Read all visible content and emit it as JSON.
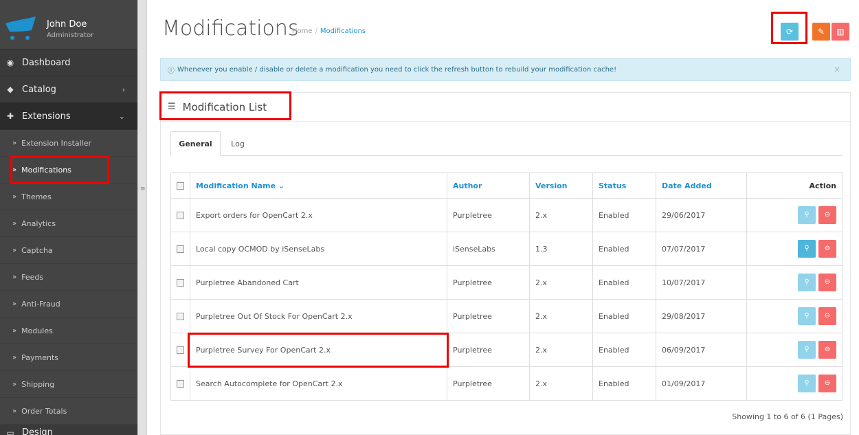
{
  "profile": {
    "name": "John Doe",
    "role": "Administrator"
  },
  "menu": [
    {
      "label": "Dashboard",
      "icon": "dashboard-icon"
    },
    {
      "label": "Catalog",
      "icon": "tag-icon"
    },
    {
      "label": "Extensions",
      "icon": "puzzle-icon"
    }
  ],
  "submenu": [
    "Extension Installer",
    "Modifications",
    "Themes",
    "Analytics",
    "Captcha",
    "Feeds",
    "Anti-Fraud",
    "Modules",
    "Payments",
    "Shipping",
    "Order Totals"
  ],
  "menu_partial": "Design",
  "page": {
    "title": "Modifications",
    "breadcrumb_home": "Home",
    "breadcrumb_current": "Modifications"
  },
  "alert": "Whenever you enable / disable or delete a modification you need to click the refresh button to rebuild your modification cache!",
  "panel_title": "Modification List",
  "tabs": [
    "General",
    "Log"
  ],
  "table": {
    "headers": [
      "Modification Name",
      "Author",
      "Version",
      "Status",
      "Date Added",
      "Action"
    ],
    "rows": [
      [
        "Export orders for OpenCart 2.x",
        "Purpletree",
        "2.x",
        "Enabled",
        "29/06/2017"
      ],
      [
        "Local copy OCMOD by iSenseLabs",
        "iSenseLabs",
        "1.3",
        "Enabled",
        "07/07/2017"
      ],
      [
        "Purpletree Abandoned Cart",
        "Purpletree",
        "2.x",
        "Enabled",
        "10/07/2017"
      ],
      [
        "Purpletree Out Of Stock For OpenCart 2.x",
        "Purpletree",
        "2.x",
        "Enabled",
        "29/08/2017"
      ],
      [
        "Purpletree Survey For OpenCart 2.x",
        "Purpletree",
        "2.x",
        "Enabled",
        "06/09/2017"
      ],
      [
        "Search Autocomplete for OpenCart 2.x",
        "Purpletree",
        "2.x",
        "Enabled",
        "01/09/2017"
      ]
    ]
  },
  "pagination": "Showing 1 to 6 of 6 (1 Pages)",
  "colors": {
    "refresh": "#5bc0de",
    "clear": "#f0752a",
    "delete": "#f56b6b",
    "highlight": "#e00000"
  }
}
